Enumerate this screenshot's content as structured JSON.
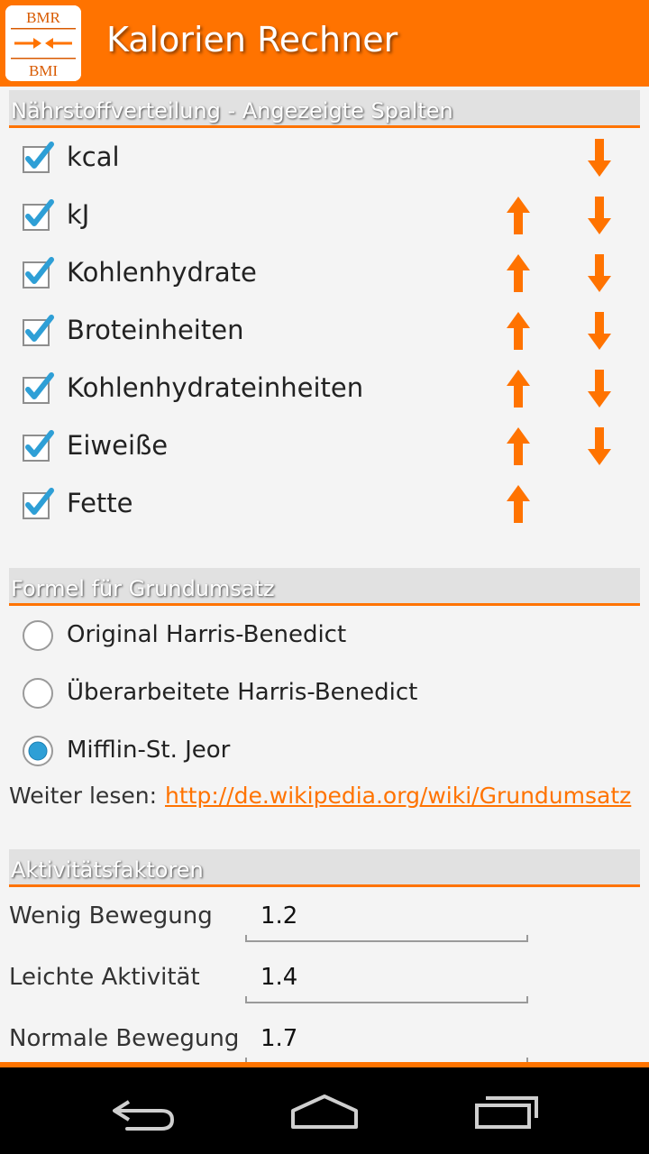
{
  "app": {
    "title": "Kalorien Rechner",
    "logo": {
      "top_text": "BMR",
      "bottom_text": "BMI",
      "icon": "bmr-bmi-logo"
    }
  },
  "colors": {
    "accent": "#ff7300",
    "check": "#2e9fd6",
    "header_bg": "#e1e1e1"
  },
  "sections": {
    "nutrients": {
      "title": "Nährstoffverteilung - Angezeigte Spalten",
      "items": [
        {
          "label": "kcal",
          "checked": true,
          "up": false,
          "down": true
        },
        {
          "label": "kJ",
          "checked": true,
          "up": true,
          "down": true
        },
        {
          "label": "Kohlenhydrate",
          "checked": true,
          "up": true,
          "down": true
        },
        {
          "label": "Broteinheiten",
          "checked": true,
          "up": true,
          "down": true
        },
        {
          "label": "Kohlenhydrateinheiten",
          "checked": true,
          "up": true,
          "down": true
        },
        {
          "label": "Eiweiße",
          "checked": true,
          "up": true,
          "down": true
        },
        {
          "label": "Fette",
          "checked": true,
          "up": true,
          "down": false
        }
      ]
    },
    "formula": {
      "title": "Formel für Grundumsatz",
      "options": [
        {
          "label": "Original Harris-Benedict",
          "selected": false
        },
        {
          "label": "Überarbeitete Harris-Benedict",
          "selected": false
        },
        {
          "label": "Mifflin-St. Jeor",
          "selected": true
        }
      ],
      "more_label": "Weiter lesen:",
      "more_link": "http://de.wikipedia.org/wiki/Grundumsatz"
    },
    "activity": {
      "title": "Aktivitätsfaktoren",
      "factors": [
        {
          "label": "Wenig Bewegung",
          "value": "1.2"
        },
        {
          "label": "Leichte Aktivität",
          "value": "1.4"
        },
        {
          "label": "Normale Bewegung",
          "value": "1.7"
        }
      ]
    }
  },
  "navbar": {
    "back_icon": "back-icon",
    "home_icon": "home-icon",
    "recents_icon": "recents-icon"
  }
}
